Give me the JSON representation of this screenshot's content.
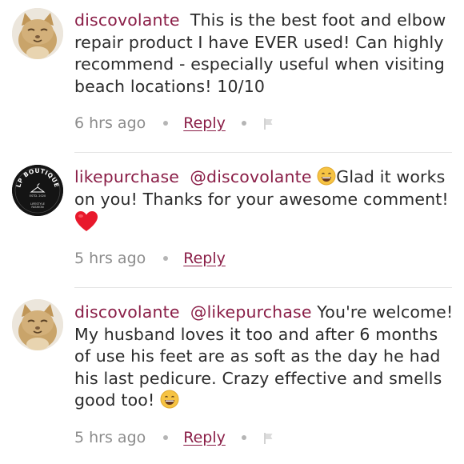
{
  "comments": [
    {
      "username": "discovolante",
      "mention": "",
      "text": "This is the best foot and elbow repair product I have EVER used! Can highly recommend - especially useful when visiting beach locations! 10/10",
      "time": "6 hrs ago",
      "reply_label": "Reply",
      "avatar": "cat-avatar",
      "has_flag": true
    },
    {
      "username": "likepurchase",
      "mention": "@discovolante",
      "text_after_emoji": "Glad it works on you!  Thanks for your awesome comment!",
      "time": "5 hrs ago",
      "reply_label": "Reply",
      "avatar": "lp-boutique-logo",
      "logo_text_top": "LP BOUTIQUE",
      "logo_text_middle": "ESTD. 2020",
      "logo_text_bottom1": "LIFESTYLE",
      "logo_text_bottom2": "FASHION",
      "has_flag": false
    },
    {
      "username": "discovolante",
      "mention": "@likepurchase",
      "text": "You're welcome! My husband loves it too and after 6 months of use his feet are as soft as the day he had his last pedicure. Crazy effective and smells good too!",
      "time": "5 hrs ago",
      "reply_label": "Reply",
      "avatar": "cat-avatar",
      "has_flag": true
    }
  ],
  "colors": {
    "username": "#8a1e47",
    "meta": "#8c8c8c",
    "text": "#2b2b2b"
  }
}
